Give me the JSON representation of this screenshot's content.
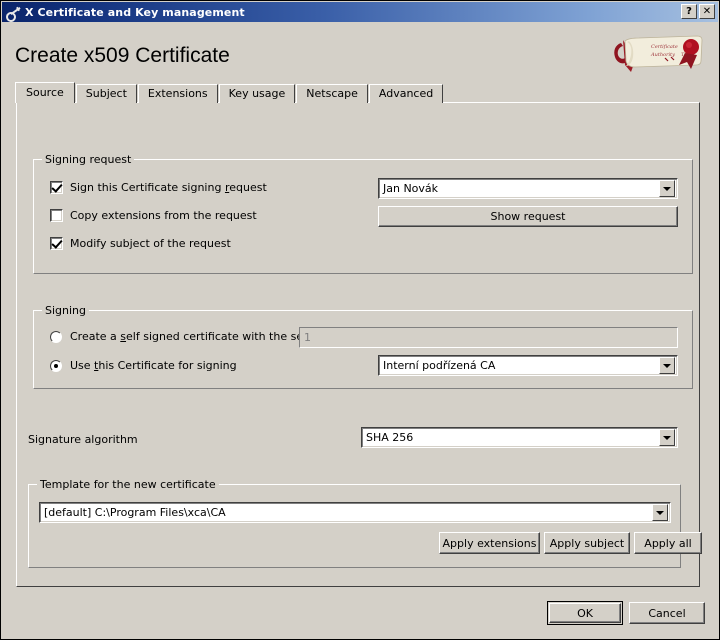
{
  "window": {
    "title": "X Certificate and Key management",
    "icon": "key-icon",
    "help_button": "?",
    "close_button": "✕"
  },
  "heading": "Create x509 Certificate",
  "logo": {
    "name": "certificate-scroll-logo"
  },
  "tabs": [
    {
      "label": "Source",
      "active": true
    },
    {
      "label": "Subject",
      "active": false
    },
    {
      "label": "Extensions",
      "active": false
    },
    {
      "label": "Key usage",
      "active": false
    },
    {
      "label": "Netscape",
      "active": false
    },
    {
      "label": "Advanced",
      "active": false
    }
  ],
  "signing_request": {
    "group_title": "Signing request",
    "sign_checkbox": {
      "label_before": "Sign this Certificate signing ",
      "label_accel": "r",
      "label_after": "equest",
      "checked": true
    },
    "copy_extensions_checkbox": {
      "label": "Copy extensions from the request",
      "checked": false
    },
    "modify_subject_checkbox": {
      "label": "Modify subject of the request",
      "checked": true
    },
    "request_combo_value": "Jan Novák",
    "show_request_button": "Show request"
  },
  "signing": {
    "group_title": "Signing",
    "self_signed_radio": {
      "label_before": "Create a ",
      "label_accel": "s",
      "label_after": "elf signed certificate with the serial",
      "selected": false
    },
    "serial_value": "1",
    "use_certificate_radio": {
      "label_before": "Use ",
      "label_accel": "t",
      "label_after": "his Certificate for signing",
      "selected": true
    },
    "ca_combo_value": "Interní podřízená CA"
  },
  "signature_algorithm": {
    "label": "Signature algorithm",
    "value": "SHA 256"
  },
  "template": {
    "group_title": "Template for the new certificate",
    "combo_value": "[default] C:\\Program Files\\xca\\CA",
    "apply_extensions_button": "Apply extensions",
    "apply_subject_button": "Apply subject",
    "apply_all_button": "Apply all"
  },
  "footer": {
    "ok_button": "OK",
    "cancel_button": "Cancel"
  },
  "colors": {
    "face": "#d4d0c8",
    "title_start": "#0a246a",
    "title_end": "#a6c0e0",
    "field": "#ffffff",
    "disabled_text": "#808080"
  }
}
